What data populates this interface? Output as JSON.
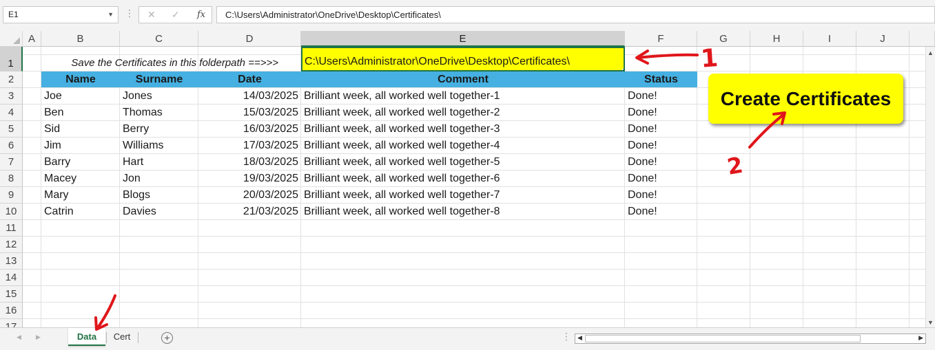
{
  "formula_bar": {
    "name_box": "E1",
    "name_box_dropdown_icon": "chevron-down-icon",
    "more_icon": "vertical-dots-icon",
    "cancel_icon": "cross-icon",
    "enter_icon": "check-icon",
    "function_icon": "fx-icon",
    "cancel_glyph": "✕",
    "enter_glyph": "✓",
    "function_glyph": "fx",
    "formula": "C:\\Users\\Administrator\\OneDrive\\Desktop\\Certificates\\"
  },
  "columns": [
    "A",
    "B",
    "C",
    "D",
    "E",
    "F",
    "G",
    "H",
    "I",
    "J"
  ],
  "selected_column": "E",
  "rows": [
    "1",
    "2",
    "3",
    "4",
    "5",
    "6",
    "7",
    "8",
    "9",
    "10",
    "11",
    "12",
    "13",
    "14",
    "15",
    "16",
    "17"
  ],
  "selected_row": "1",
  "sheet": {
    "save_label": "Save the Certificates in this folderpath ==>>>",
    "folder_path": "C:\\Users\\Administrator\\OneDrive\\Desktop\\Certificates\\",
    "folder_path_fill": "#ffff00",
    "header_fill": "#45b0e1",
    "headers": {
      "name": "Name",
      "surname": "Surname",
      "date": "Date",
      "comment": "Comment",
      "status": "Status"
    },
    "records": [
      {
        "name": "Joe",
        "surname": "Jones",
        "date": "14/03/2025",
        "comment": "Brilliant week, all worked well together-1",
        "status": "Done!"
      },
      {
        "name": "Ben",
        "surname": "Thomas",
        "date": "15/03/2025",
        "comment": "Brilliant week, all worked well together-2",
        "status": "Done!"
      },
      {
        "name": "Sid",
        "surname": "Berry",
        "date": "16/03/2025",
        "comment": "Brilliant week, all worked well together-3",
        "status": "Done!"
      },
      {
        "name": "Jim",
        "surname": "Williams",
        "date": "17/03/2025",
        "comment": "Brilliant week, all worked well together-4",
        "status": "Done!"
      },
      {
        "name": "Barry",
        "surname": "Hart",
        "date": "18/03/2025",
        "comment": "Brilliant week, all worked well together-5",
        "status": "Done!"
      },
      {
        "name": "Macey",
        "surname": "Jon",
        "date": "19/03/2025",
        "comment": "Brilliant week, all worked well together-6",
        "status": "Done!"
      },
      {
        "name": "Mary",
        "surname": "Blogs",
        "date": "20/03/2025",
        "comment": "Brilliant week, all worked well together-7",
        "status": "Done!"
      },
      {
        "name": "Catrin",
        "surname": "Davies",
        "date": "21/03/2025",
        "comment": "Brilliant week, all worked well together-8",
        "status": "Done!"
      }
    ]
  },
  "create_button": {
    "label": "Create Certificates",
    "fill": "#ffff00"
  },
  "annotations": {
    "step_1": "1",
    "step_2": "2",
    "color": "#e0161b"
  },
  "tabs": [
    {
      "label": "Data",
      "active": true
    },
    {
      "label": "Cert",
      "active": false
    }
  ],
  "tab_bar": {
    "add_sheet_icon": "plus-circle-icon",
    "add_sheet_glyph": "+",
    "prev_icon": "chevron-left-icon",
    "next_icon": "chevron-right-icon",
    "accent": "#217346"
  }
}
